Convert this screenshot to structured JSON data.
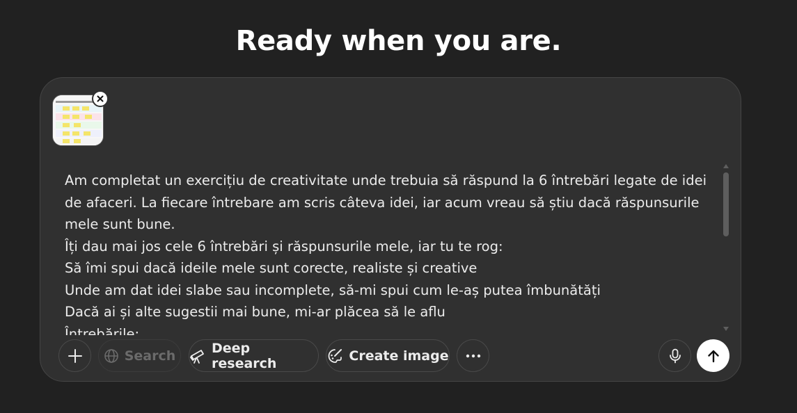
{
  "header": {
    "title": "Ready when you are."
  },
  "composer": {
    "attachment": {
      "icon": "image-thumbnail-icon"
    },
    "message_lines": [
      "Am completat un exercițiu de creativitate unde trebuia să răspund la 6 întrebări legate de idei de afaceri. La fiecare întrebare am scris câteva idei, iar acum vreau să știu dacă răspunsurile mele sunt bune.",
      "Îți dau mai jos cele 6 întrebări și răspunsurile mele, iar tu te rog:",
      "Să îmi spui dacă ideile mele sunt corecte, realiste și creative",
      "Unde am dat idei slabe sau incomplete, să-mi spui cum le-aș putea îmbunătăți",
      "Dacă ai și alte sugestii mai bune, mi-ar plăcea să le aflu",
      "Întrebările:"
    ]
  },
  "toolbar": {
    "search_label": "Search",
    "deep_research_label": "Deep research",
    "create_image_label": "Create image"
  },
  "colors": {
    "background": "#212121",
    "composer": "#303030",
    "text": "#ececec"
  }
}
